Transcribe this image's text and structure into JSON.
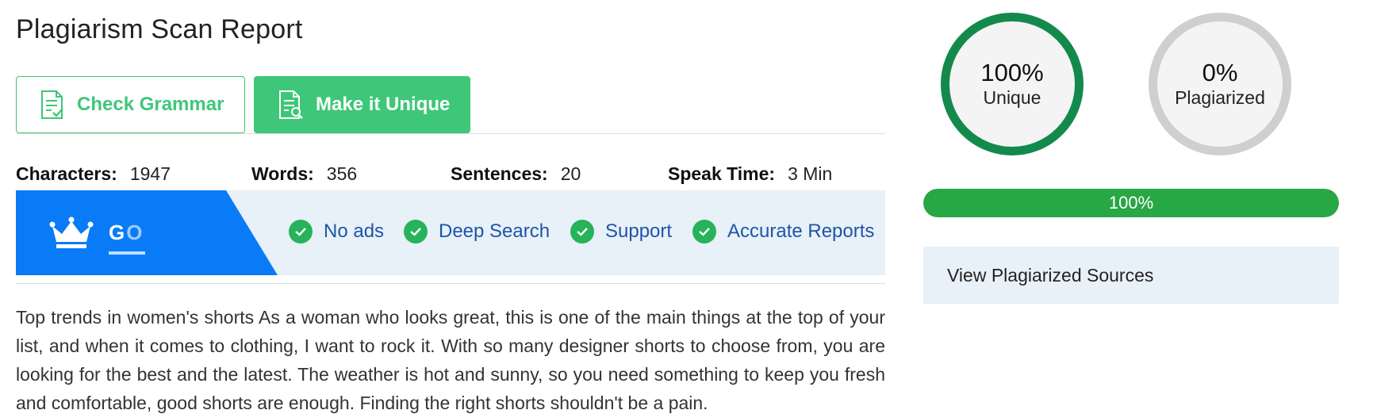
{
  "report": {
    "title": "Plagiarism Scan Report"
  },
  "toolbar": {
    "check_grammar_label": "Check Grammar",
    "make_unique_label": "Make it Unique"
  },
  "stats": {
    "characters_label": "Characters:",
    "characters_value": "1947",
    "words_label": "Words:",
    "words_value": "356",
    "sentences_label": "Sentences:",
    "sentences_value": "20",
    "speak_time_label": "Speak Time:",
    "speak_time_value": "3 Min"
  },
  "promo": {
    "go_text_g": "G",
    "go_text_o": "O",
    "features": [
      "No ads",
      "Deep Search",
      "Support",
      "Accurate Reports"
    ]
  },
  "content": {
    "text": "Top trends in women's shorts As a woman who looks great, this is one of the main things at the top of your list, and when it comes to clothing, I want to rock it. With so many designer shorts to choose from, you are looking for the best and the latest. The weather is hot and sunny, so you need something to keep you fresh and comfortable, good shorts are enough. Finding the right shorts shouldn't be a pain."
  },
  "results": {
    "unique_pct": "100%",
    "unique_label": "Unique",
    "plagiarized_pct": "0%",
    "plagiarized_label": "Plagiarized",
    "progress_text": "100%",
    "progress_value": 1.0,
    "view_sources_label": "View Plagiarized Sources"
  },
  "colors": {
    "accent_green": "#3ec778",
    "ring_green": "#138a4c",
    "progress_green": "#28a745",
    "promo_blue": "#0a7bf7",
    "feature_text_blue": "#1d55a8",
    "panel_bg": "#e8f0f8"
  },
  "icons": {
    "check_grammar": "document-check-icon",
    "make_unique": "document-search-icon",
    "crown": "crown-icon",
    "feature_check": "check-circle-icon"
  }
}
